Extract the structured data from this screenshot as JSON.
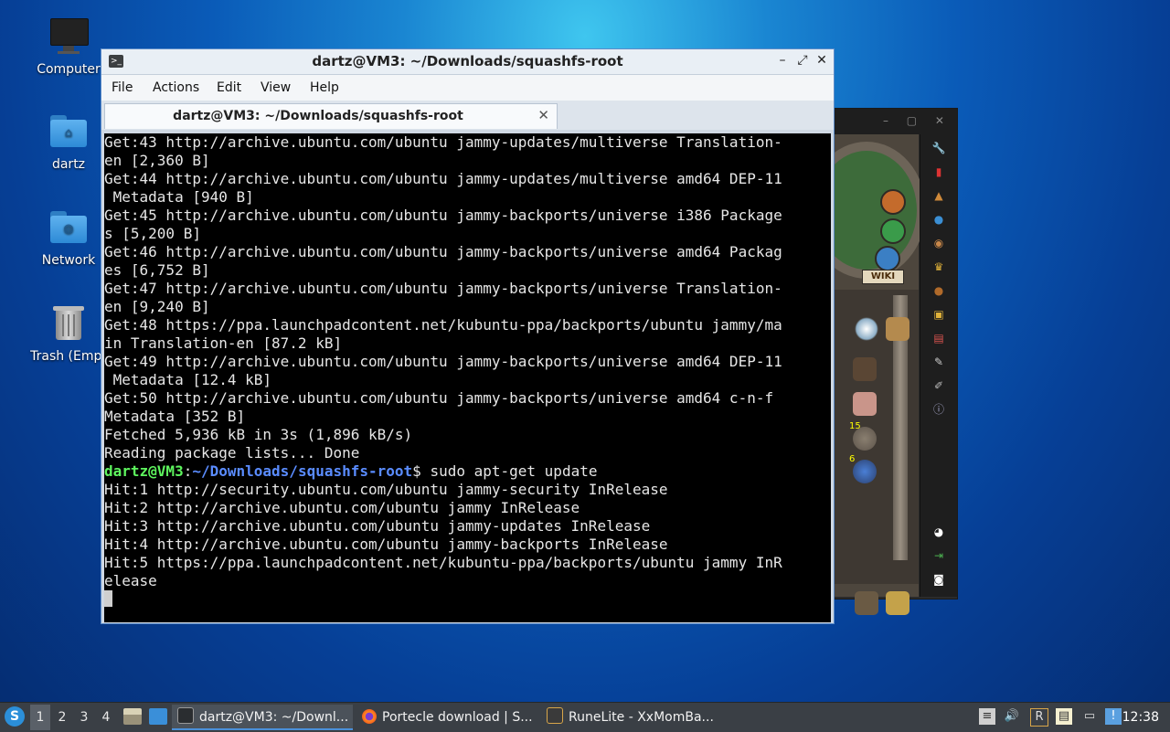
{
  "desktop": {
    "icons": [
      {
        "label": "Computer",
        "icon": "computer-icon"
      },
      {
        "label": "dartz",
        "icon": "home-folder-icon"
      },
      {
        "label": "Network",
        "icon": "network-folder-icon"
      },
      {
        "label": "Trash (Empt",
        "icon": "trash-icon"
      }
    ]
  },
  "terminal": {
    "title": "dartz@VM3: ~/Downloads/squashfs-root",
    "controls": {
      "minimize": "–",
      "maximize": "⤢",
      "close": "✕"
    },
    "menu": [
      "File",
      "Actions",
      "Edit",
      "View",
      "Help"
    ],
    "tab": {
      "title": "dartz@VM3: ~/Downloads/squashfs-root",
      "close": "✕"
    },
    "lines_before": [
      "Get:43 http://archive.ubuntu.com/ubuntu jammy-updates/multiverse Translation-",
      "en [2,360 B]",
      "Get:44 http://archive.ubuntu.com/ubuntu jammy-updates/multiverse amd64 DEP-11",
      " Metadata [940 B]",
      "Get:45 http://archive.ubuntu.com/ubuntu jammy-backports/universe i386 Package",
      "s [5,200 B]",
      "Get:46 http://archive.ubuntu.com/ubuntu jammy-backports/universe amd64 Packag",
      "es [6,752 B]",
      "Get:47 http://archive.ubuntu.com/ubuntu jammy-backports/universe Translation-",
      "en [9,240 B]",
      "Get:48 https://ppa.launchpadcontent.net/kubuntu-ppa/backports/ubuntu jammy/ma",
      "in Translation-en [87.2 kB]",
      "Get:49 http://archive.ubuntu.com/ubuntu jammy-backports/universe amd64 DEP-11",
      " Metadata [12.4 kB]",
      "Get:50 http://archive.ubuntu.com/ubuntu jammy-backports/universe amd64 c-n-f",
      "Metadata [352 B]",
      "Fetched 5,936 kB in 3s (1,896 kB/s)",
      "Reading package lists... Done"
    ],
    "prompt": {
      "user_host": "dartz@VM3",
      "sep": ":",
      "path": "~/Downloads/squashfs-root",
      "dollar": "$",
      "command": " sudo apt-get update"
    },
    "lines_after": [
      "Hit:1 http://security.ubuntu.com/ubuntu jammy-security InRelease",
      "Hit:2 http://archive.ubuntu.com/ubuntu jammy InRelease",
      "Hit:3 http://archive.ubuntu.com/ubuntu jammy-updates InRelease",
      "Hit:4 http://archive.ubuntu.com/ubuntu jammy-backports InRelease",
      "Hit:5 https://ppa.launchpadcontent.net/kubuntu-ppa/backports/ubuntu jammy InR",
      "elease"
    ]
  },
  "runelite": {
    "wiki_label": "WIKI",
    "item_counts": [
      "15",
      "6"
    ]
  },
  "taskbar": {
    "workspaces": [
      "1",
      "2",
      "3",
      "4"
    ],
    "active_workspace": "1",
    "tasks": [
      {
        "label": "dartz@VM3: ~/Downl...",
        "icon": "terminal-icon",
        "active": true
      },
      {
        "label": "Portecle download | S...",
        "icon": "firefox-icon",
        "active": false
      },
      {
        "label": "RuneLite - XxMomBa...",
        "icon": "runelite-icon",
        "active": false
      }
    ],
    "clock": "12:38"
  },
  "colors": {
    "prompt_user": "#5ef55e",
    "prompt_path": "#5a8cff",
    "terminal_bg": "#000000",
    "window_border": "#5c8cc9"
  }
}
